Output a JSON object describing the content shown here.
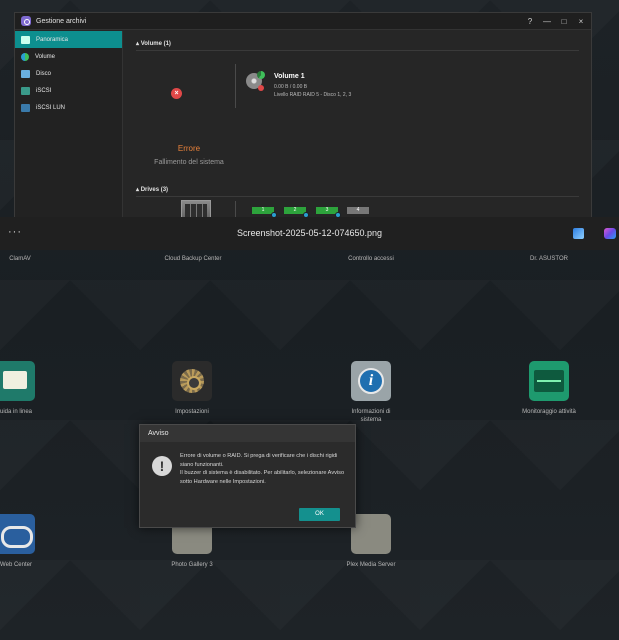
{
  "window": {
    "title": "Gestione archivi",
    "controls": [
      "?",
      "—",
      "□",
      "×"
    ]
  },
  "sidebar": {
    "items": [
      {
        "label": "Panoramica",
        "icon": "overview-icon",
        "active": true
      },
      {
        "label": "Volume",
        "icon": "volume-icon",
        "active": false
      },
      {
        "label": "Disco",
        "icon": "disk-icon",
        "active": false
      },
      {
        "label": "iSCSI",
        "icon": "iscsi-icon",
        "active": false
      },
      {
        "label": "iSCSI LUN",
        "icon": "iscsi-lun-icon",
        "active": false
      }
    ]
  },
  "volumes_section": {
    "heading": "Volume (1)",
    "volume": {
      "name": "Volume 1",
      "size": "0.00 B / 0.00 B",
      "level": "Livello RAID RAID 5 - Disco 1, 2, 3"
    },
    "error_title": "Errore",
    "error_desc": "Fallimento del sistema"
  },
  "drives_section": {
    "heading": "Drives (3)",
    "drives": [
      "1",
      "2",
      "3",
      "4"
    ]
  },
  "viewer": {
    "menu": "···",
    "filename": "Screenshot-2025-05-12-074650.png"
  },
  "desktop": {
    "top_labels": [
      "ClamAV",
      "Cloud Backup Center",
      "Controllo accessi",
      "Dr. ASUSTOR"
    ],
    "apps_row1": [
      "uida in linea",
      "Impostazioni",
      "Informazioni di sistema",
      "Monitoraggio attività"
    ],
    "apps_row2": [
      "Web Center",
      "Photo Gallery 3",
      "Plex Media Server"
    ]
  },
  "dialog": {
    "title": "Avviso",
    "message_line1": "Errore di volume o RAID. Si prega di verificare che i dischi rigidi siano funzionanti.",
    "message_line2": "Il buzzer di sistema è disabilitato. Per abilitarlo, selezionare Avviso sotto Hardware nelle Impostazioni.",
    "ok_label": "OK",
    "icon": "exclamation-icon"
  },
  "colors": {
    "accent": "#0d8f8f",
    "error": "#e04848",
    "error_text": "#e8813a",
    "drive_ok": "#2da33c"
  }
}
